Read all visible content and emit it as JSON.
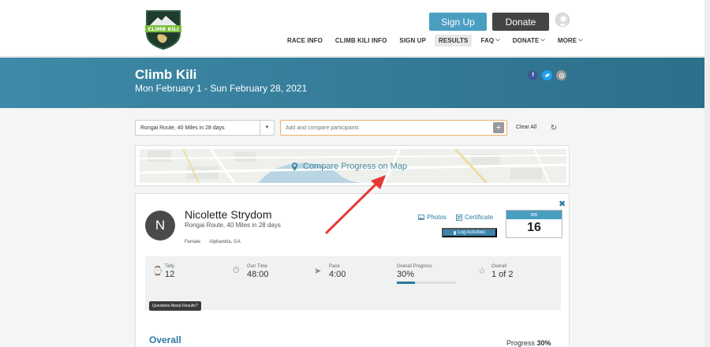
{
  "header": {
    "logo_text": "CLIMB KILI",
    "signup_label": "Sign Up",
    "donate_label": "Donate",
    "nav": [
      {
        "label": "RACE INFO",
        "dropdown": false,
        "active": false
      },
      {
        "label": "CLIMB KILI INFO",
        "dropdown": false,
        "active": false
      },
      {
        "label": "SIGN UP",
        "dropdown": false,
        "active": false
      },
      {
        "label": "RESULTS",
        "dropdown": false,
        "active": true
      },
      {
        "label": "FAQ",
        "dropdown": true,
        "active": false
      },
      {
        "label": "DONATE",
        "dropdown": true,
        "active": false
      },
      {
        "label": "MORE",
        "dropdown": true,
        "active": false
      }
    ]
  },
  "banner": {
    "title": "Climb Kili",
    "date": "Mon February 1 - Sun February 28, 2021",
    "social": [
      "facebook-icon",
      "twitter-icon",
      "email-icon"
    ]
  },
  "filters": {
    "route_select": "Rongai Route, 40 Miles in 28 days",
    "compare_placeholder": "Add and compare participants",
    "clear_all": "Clear All"
  },
  "map": {
    "label": "Compare Progress on Map"
  },
  "participant": {
    "initial": "N",
    "name": "Nicolette Strydom",
    "route": "Rongai Route, 40 Miles in 28 days",
    "gender": "Female",
    "location": "Alpharetta, GA",
    "photos_label": "Photos",
    "certificate_label": "Certificate",
    "log_label": "Log Activities",
    "bib_label": "BIB",
    "bib_number": "16"
  },
  "stats": {
    "tally_label": "Tally",
    "tally_value": "12",
    "gun_label": "Gun Time",
    "gun_value": "48:00",
    "pace_label": "Pace",
    "pace_value": "4:00",
    "progress_label": "Overall Progress",
    "progress_value": "30%",
    "progress_fraction": 0.3,
    "overall_label": "Overall",
    "overall_value": "1 of 2",
    "questions_label": "Questions About Results?"
  },
  "overall": {
    "heading": "Overall",
    "progress_label": "Progress",
    "progress_value": "30%"
  },
  "colors": {
    "primary": "#2c7aa0",
    "signup": "#4a9ec2",
    "donate": "#444444",
    "banner": "#2c6f8a"
  }
}
